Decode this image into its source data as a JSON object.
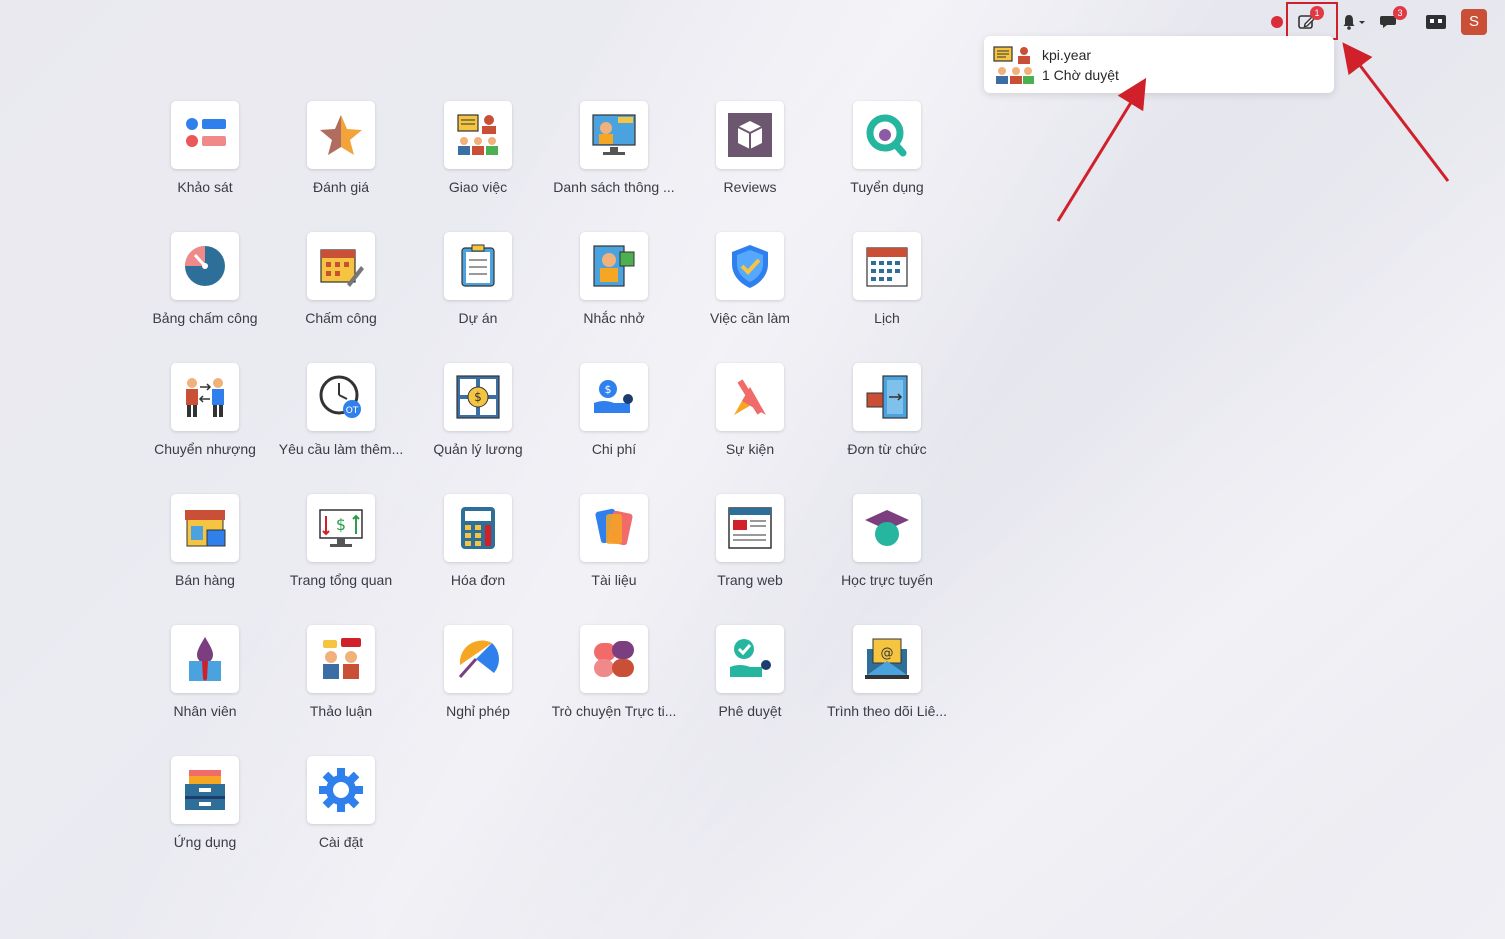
{
  "topbar": {
    "activity_badge": "1",
    "messages_badge": "3",
    "avatar_letter": "S"
  },
  "dropdown": {
    "model": "kpi.year",
    "status": "1 Chờ duyệt"
  },
  "apps": [
    {
      "label": "Khảo sát",
      "icon": "survey-icon"
    },
    {
      "label": "Đánh giá",
      "icon": "star-icon"
    },
    {
      "label": "Giao việc",
      "icon": "assign-task-icon"
    },
    {
      "label": "Danh sách thông ...",
      "icon": "news-icon"
    },
    {
      "label": "Reviews",
      "icon": "box-icon"
    },
    {
      "label": "Tuyển dụng",
      "icon": "recruitment-icon"
    },
    {
      "label": "Bảng chấm công",
      "icon": "gauge-icon"
    },
    {
      "label": "Chấm công",
      "icon": "calendar-pencil-icon"
    },
    {
      "label": "Dự án",
      "icon": "clipboard-icon"
    },
    {
      "label": "Nhắc nhở",
      "icon": "reminder-icon"
    },
    {
      "label": "Việc cần làm",
      "icon": "shield-check-icon"
    },
    {
      "label": "Lịch",
      "icon": "calendar-icon"
    },
    {
      "label": "Chuyển nhượng",
      "icon": "transfer-icon"
    },
    {
      "label": "Yêu cầu làm thêm...",
      "icon": "overtime-clock-icon"
    },
    {
      "label": "Quản lý lương",
      "icon": "payroll-icon"
    },
    {
      "label": "Chi phí",
      "icon": "expense-icon"
    },
    {
      "label": "Sự kiện",
      "icon": "event-icon"
    },
    {
      "label": "Đơn từ chức",
      "icon": "resignation-door-icon"
    },
    {
      "label": "Bán hàng",
      "icon": "shop-icon"
    },
    {
      "label": "Trang tổng quan",
      "icon": "dashboard-monitor-icon"
    },
    {
      "label": "Hóa đơn",
      "icon": "calculator-icon"
    },
    {
      "label": "Tài liệu",
      "icon": "documents-icon"
    },
    {
      "label": "Trang web",
      "icon": "website-icon"
    },
    {
      "label": "Học trực tuyến",
      "icon": "graduation-cap-icon"
    },
    {
      "label": "Nhân viên",
      "icon": "employee-icon"
    },
    {
      "label": "Thảo luận",
      "icon": "discussion-icon"
    },
    {
      "label": "Nghỉ phép",
      "icon": "umbrella-icon"
    },
    {
      "label": "Trò chuyện Trực ti...",
      "icon": "live-chat-icon"
    },
    {
      "label": "Phê duyệt",
      "icon": "approval-icon"
    },
    {
      "label": "Trình theo dõi Liê...",
      "icon": "mail-tracker-icon"
    },
    {
      "label": "Ứng dụng",
      "icon": "apps-drawer-icon"
    },
    {
      "label": "Cài đặt",
      "icon": "gear-icon"
    }
  ]
}
